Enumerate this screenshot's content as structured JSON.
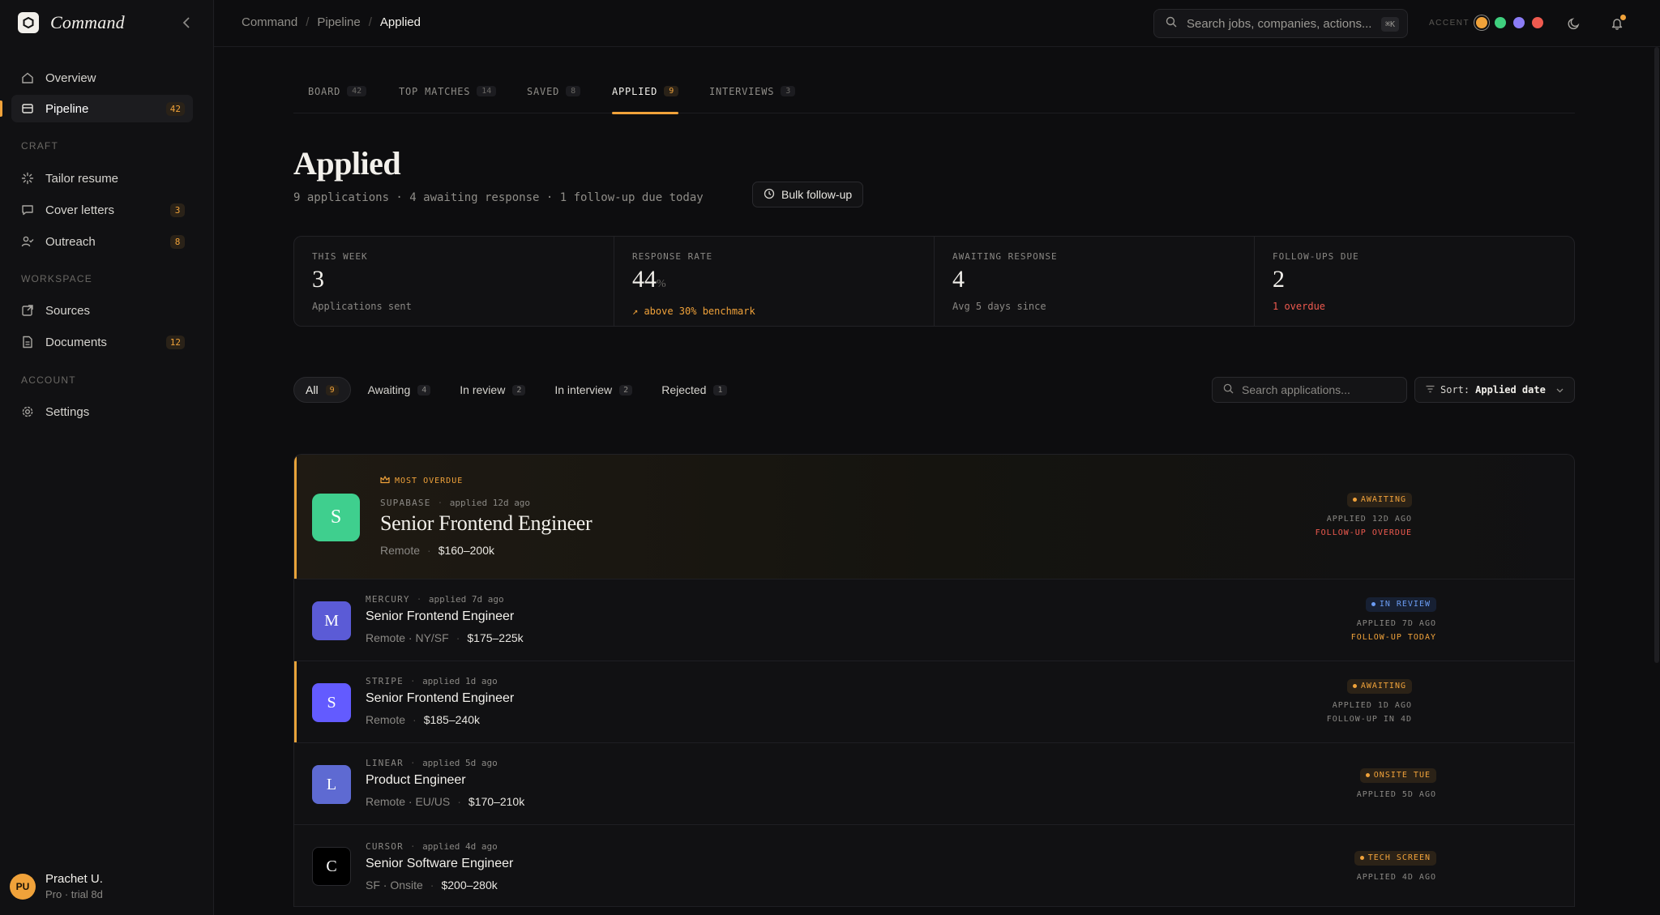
{
  "app": {
    "name": "Command"
  },
  "sidebar": {
    "nav": [
      {
        "label": "Overview",
        "icon": "home-icon"
      },
      {
        "label": "Pipeline",
        "icon": "board-icon",
        "badge": "42",
        "active": true
      }
    ],
    "sections": [
      {
        "title": "CRAFT",
        "items": [
          {
            "label": "Tailor resume",
            "icon": "sparkle-icon"
          },
          {
            "label": "Cover letters",
            "icon": "chat-icon",
            "badge": "3"
          },
          {
            "label": "Outreach",
            "icon": "user-check-icon",
            "badge": "8"
          }
        ]
      },
      {
        "title": "WORKSPACE",
        "items": [
          {
            "label": "Sources",
            "icon": "external-link-icon"
          },
          {
            "label": "Documents",
            "icon": "file-icon",
            "badge": "12"
          }
        ]
      },
      {
        "title": "ACCOUNT",
        "items": [
          {
            "label": "Settings",
            "icon": "gear-icon"
          }
        ]
      }
    ],
    "user": {
      "initials": "PU",
      "name": "Prachet U.",
      "plan": "Pro · trial 8d"
    }
  },
  "topbar": {
    "breadcrumb": [
      "Command",
      "Pipeline",
      "Applied"
    ],
    "search_placeholder": "Search jobs, companies, actions...",
    "search_shortcut": "⌘K",
    "accent_label": "ACCENT",
    "accent_colors": [
      "#f0a23a",
      "#3fcf7e",
      "#8b7cf6",
      "#ef5a4f"
    ]
  },
  "tabs": [
    {
      "label": "BOARD",
      "count": "42"
    },
    {
      "label": "TOP MATCHES",
      "count": "14"
    },
    {
      "label": "SAVED",
      "count": "8"
    },
    {
      "label": "APPLIED",
      "count": "9",
      "active": true
    },
    {
      "label": "INTERVIEWS",
      "count": "3"
    }
  ],
  "page": {
    "title": "Applied",
    "subtitle": "9 applications · 4 awaiting response · 1 follow-up due today",
    "bulk_label": "Bulk follow-up"
  },
  "stats": [
    {
      "label": "THIS WEEK",
      "value": "3",
      "unit": "",
      "note": "Applications sent",
      "tone": ""
    },
    {
      "label": "RESPONSE RATE",
      "value": "44",
      "unit": "%",
      "note": "↗ above 30% benchmark",
      "tone": "orange"
    },
    {
      "label": "AWAITING RESPONSE",
      "value": "4",
      "unit": "",
      "note": "Avg 5 days since",
      "tone": ""
    },
    {
      "label": "FOLLOW-UPS DUE",
      "value": "2",
      "unit": "",
      "note": "1 overdue",
      "tone": "red"
    }
  ],
  "filters": [
    {
      "label": "All",
      "count": "9",
      "active": true
    },
    {
      "label": "Awaiting",
      "count": "4"
    },
    {
      "label": "In review",
      "count": "2"
    },
    {
      "label": "In interview",
      "count": "2"
    },
    {
      "label": "Rejected",
      "count": "1"
    }
  ],
  "list_search_placeholder": "Search applications...",
  "sort": {
    "prefix": "Sort:",
    "value": "Applied date"
  },
  "applications": [
    {
      "tag": "MOST OVERDUE",
      "initial": "S",
      "company": "SUPABASE",
      "when": "applied 12d ago",
      "role": "Senior Frontend Engineer",
      "location": "Remote",
      "salary": "$160–200k",
      "status": "AWAITING",
      "status_tone": "amber",
      "line1": "APPLIED 12D AGO",
      "line2": "FOLLOW-UP OVERDUE",
      "line2_tone": "red",
      "logo_color": "#3fcf8e"
    },
    {
      "initial": "M",
      "company": "MERCURY",
      "when": "applied 7d ago",
      "role": "Senior Frontend Engineer",
      "location": "Remote · NY/SF",
      "salary": "$175–225k",
      "status": "IN REVIEW",
      "status_tone": "blue",
      "line1": "APPLIED 7D AGO",
      "line2": "FOLLOW-UP TODAY",
      "line2_tone": "orange",
      "logo_color": "#5b5bd6"
    },
    {
      "initial": "S",
      "company": "STRIPE",
      "when": "applied 1d ago",
      "role": "Senior Frontend Engineer",
      "location": "Remote",
      "salary": "$185–240k",
      "status": "AWAITING",
      "status_tone": "amber",
      "line1": "APPLIED 1D AGO",
      "line2": "FOLLOW-UP IN 4D",
      "line2_tone": "gray",
      "logo_color": "#635bff"
    },
    {
      "initial": "L",
      "company": "LINEAR",
      "when": "applied 5d ago",
      "role": "Product Engineer",
      "location": "Remote · EU/US",
      "salary": "$170–210k",
      "status": "ONSITE TUE",
      "status_tone": "amber",
      "line1": "APPLIED 5D AGO",
      "line2": "",
      "line2_tone": "gray",
      "logo_color": "#5e6ad2"
    },
    {
      "initial": "C",
      "company": "CURSOR",
      "when": "applied 4d ago",
      "role": "Senior Software Engineer",
      "location": "SF · Onsite",
      "salary": "$200–280k",
      "status": "TECH SCREEN",
      "status_tone": "amber",
      "line1": "APPLIED 4D AGO",
      "line2": "",
      "line2_tone": "gray",
      "logo_color": "#000000"
    }
  ]
}
